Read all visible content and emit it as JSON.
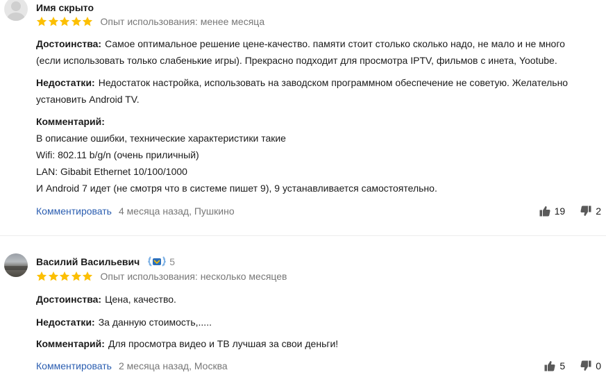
{
  "reviews": [
    {
      "author": "Имя скрыто",
      "experience": "Опыт использования: менее месяца",
      "rating": 5,
      "pros_label": "Достоинства:",
      "pros": "Самое оптимальное решение цене-качество. памяти стоит столько сколько надо, не мало и не много (если использовать только слабенькие игры). Прекрасно подходит для просмотра IPTV, фильмов с инета, Yootube.",
      "cons_label": "Недостатки:",
      "cons": "Недостаток настройка, использовать на заводском программном обеспечение не советую. Желательно установить Android TV.",
      "comment_label": "Комментарий:",
      "comment_lines": [
        "В описание ошибки, технические характеристики такие",
        "Wifi: 802.11 b/g/n (очень приличный)",
        "LAN: Gibabit Ethernet 10/100/1000",
        "И Android 7 идет (не смотря что в системе пишет 9), 9 устанавливается самостоятельно."
      ],
      "comment_action": "Комментировать",
      "meta": "4 месяца назад, Пушкино",
      "likes": "19",
      "dislikes": "2"
    },
    {
      "author": "Василий Васильевич",
      "badge_count": "5",
      "experience": "Опыт использования: несколько месяцев",
      "rating": 5,
      "pros_label": "Достоинства:",
      "pros": "Цена, качество.",
      "cons_label": "Недостатки:",
      "cons": "За данную стоимость,.....",
      "comment_label": "Комментарий:",
      "comment": "Для просмотра видео и ТВ лучшая за свои деньги!",
      "comment_action": "Комментировать",
      "meta": "2 месяца назад, Москва",
      "likes": "5",
      "dislikes": "0"
    }
  ],
  "colors": {
    "star": "#fcbf02",
    "link": "#2a5db0",
    "muted": "#777777",
    "text": "#1a1a1a",
    "badge_laurel": "#7fb2e5",
    "badge_shield": "#2a6fbd"
  },
  "icons": [
    "star-icon",
    "thumbs-up-icon",
    "thumbs-down-icon",
    "reviewer-badge-icon",
    "avatar-placeholder"
  ]
}
